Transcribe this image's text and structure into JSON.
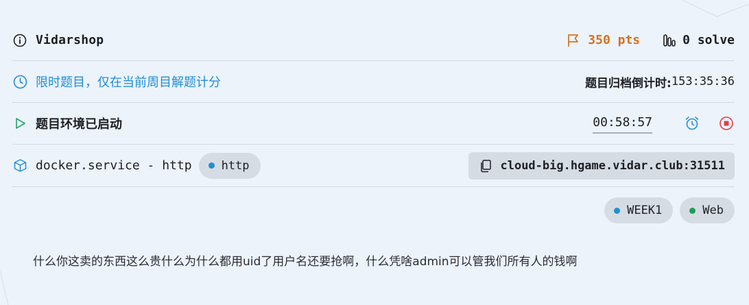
{
  "challenge": {
    "name": "Vidarshop",
    "points": "350 pts",
    "solves": "0 solve"
  },
  "limit": {
    "notice": "限时题目，仅在当前周目解题计分",
    "archive_label": "题目归档倒计时:",
    "archive_countdown": "153:35:36"
  },
  "environment": {
    "status": "题目环境已启动",
    "timer": "00:58:57"
  },
  "service": {
    "label": "docker.service - http",
    "protocol": "http",
    "address": "cloud-big.hgame.vidar.club:31511"
  },
  "tags": [
    {
      "label": "WEEK1",
      "color": "#1f8fd8"
    },
    {
      "label": "Web",
      "color": "#1f9d55"
    }
  ],
  "description": "什么你这卖的东西这么贵什么为什么都用uid了用户名还要抢啊，什么凭啥admin可以管我们所有人的钱啊",
  "colors": {
    "accent": "#1f8fd8",
    "points": "#d9711f",
    "stop": "#e0404a",
    "play": "#2aa866"
  }
}
